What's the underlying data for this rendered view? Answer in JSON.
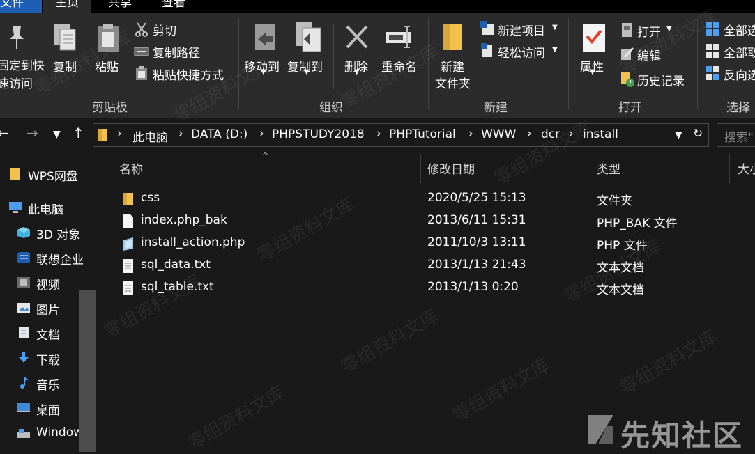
{
  "tabs": {
    "file": "文件",
    "home": "主页",
    "share": "共享",
    "view": "查看"
  },
  "ribbon": {
    "clipboard": {
      "pin_line1": "固定到快",
      "pin_line2": "速访问",
      "copy": "复制",
      "paste": "粘贴",
      "cut": "剪切",
      "copy_path": "复制路径",
      "paste_shortcut": "粘贴快捷方式",
      "group": "剪贴板"
    },
    "organize": {
      "move_to": "移动到",
      "copy_to": "复制到",
      "delete": "删除",
      "rename": "重命名",
      "group": "组织"
    },
    "new": {
      "new_folder_line1": "新建",
      "new_folder_line2": "文件夹",
      "new_item": "新建项目",
      "easy_access": "轻松访问",
      "group": "新建"
    },
    "open": {
      "properties": "属性",
      "open": "打开",
      "edit": "编辑",
      "history": "历史记录",
      "group": "打开"
    },
    "select": {
      "select_all": "全部选",
      "select_none": "全部取",
      "invert": "反向选",
      "group": "选择"
    }
  },
  "address": {
    "crumbs": [
      "此电脑",
      "DATA (D:)",
      "PHPSTUDY2018",
      "PHPTutorial",
      "WWW",
      "dcr",
      "install"
    ],
    "search_placeholder": "搜索\""
  },
  "sidebar": {
    "items": [
      {
        "label": "WPS网盘"
      },
      {
        "label": "此电脑"
      },
      {
        "label": "3D 对象"
      },
      {
        "label": "联想企业"
      },
      {
        "label": "视频"
      },
      {
        "label": "图片"
      },
      {
        "label": "文档"
      },
      {
        "label": "下载"
      },
      {
        "label": "音乐"
      },
      {
        "label": "桌面"
      },
      {
        "label": "Windows"
      }
    ]
  },
  "columns": {
    "name": "名称",
    "modified": "修改日期",
    "type": "类型",
    "size": "大小"
  },
  "files": [
    {
      "name": "css",
      "modified": "2020/5/25 15:13",
      "type": "文件夹",
      "icon": "folder-icon"
    },
    {
      "name": "index.php_bak",
      "modified": "2013/6/11 15:31",
      "type": "PHP_BAK 文件",
      "icon": "file-icon"
    },
    {
      "name": "install_action.php",
      "modified": "2011/10/3 13:11",
      "type": "PHP 文件",
      "icon": "php-file-icon"
    },
    {
      "name": "sql_data.txt",
      "modified": "2013/1/13 21:43",
      "type": "文本文档",
      "icon": "text-file-icon"
    },
    {
      "name": "sql_table.txt",
      "modified": "2013/1/13 0:20",
      "type": "文本文档",
      "icon": "text-file-icon"
    }
  ],
  "watermark": {
    "text": "零组资料文库",
    "brand": "先知社区"
  },
  "colors": {
    "background": "#191919",
    "ribbon": "#2b2b2b",
    "file_tab": "#1f5fb3",
    "folder": "#f2c14e"
  }
}
